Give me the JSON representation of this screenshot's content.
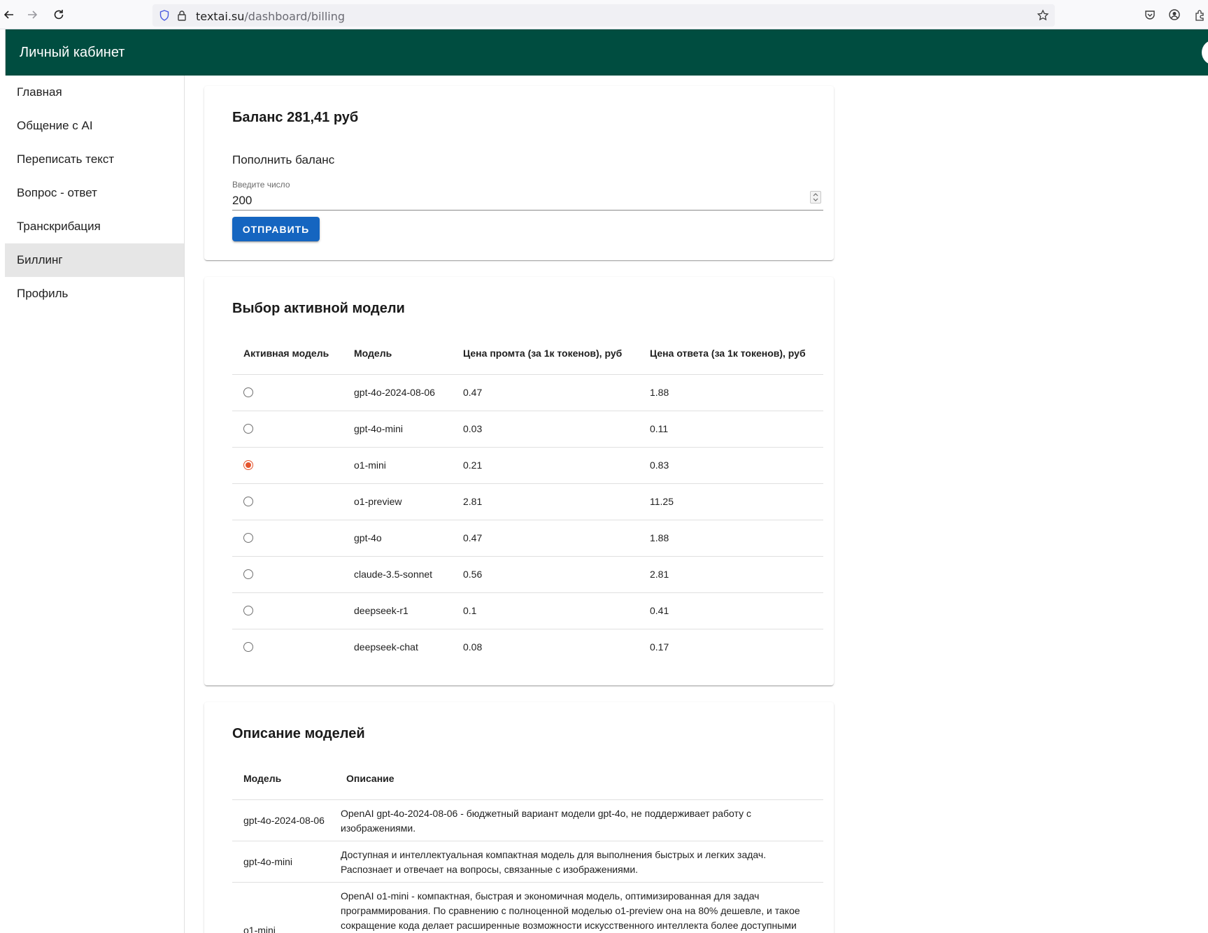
{
  "browser": {
    "url_host": "textai.su",
    "url_path": "/dashboard/billing"
  },
  "header": {
    "title": "Личный кабинет"
  },
  "sidebar": {
    "items": [
      {
        "label": "Главная"
      },
      {
        "label": "Общение с AI"
      },
      {
        "label": "Переписать текст"
      },
      {
        "label": "Вопрос - ответ"
      },
      {
        "label": "Транскрибация"
      },
      {
        "label": "Биллинг",
        "active": true
      },
      {
        "label": "Профиль"
      }
    ]
  },
  "balance": {
    "title": "Баланс 281,41 руб",
    "topup_label": "Пополнить баланс",
    "input_label": "Введите число",
    "input_value": "200",
    "submit_label": "ОТПРАВИТЬ"
  },
  "models": {
    "title": "Выбор активной модели",
    "headers": [
      "Активная модель",
      "Модель",
      "Цена промта (за 1к токенов), руб",
      "Цена ответа (за 1к токенов), руб"
    ],
    "rows": [
      {
        "model": "gpt-4o-2024-08-06",
        "prompt_price": "0.47",
        "answer_price": "1.88",
        "active": false
      },
      {
        "model": "gpt-4o-mini",
        "prompt_price": "0.03",
        "answer_price": "0.11",
        "active": false
      },
      {
        "model": "o1-mini",
        "prompt_price": "0.21",
        "answer_price": "0.83",
        "active": true
      },
      {
        "model": "o1-preview",
        "prompt_price": "2.81",
        "answer_price": "11.25",
        "active": false
      },
      {
        "model": "gpt-4o",
        "prompt_price": "0.47",
        "answer_price": "1.88",
        "active": false
      },
      {
        "model": "claude-3.5-sonnet",
        "prompt_price": "0.56",
        "answer_price": "2.81",
        "active": false
      },
      {
        "model": "deepseek-r1",
        "prompt_price": "0.1",
        "answer_price": "0.41",
        "active": false
      },
      {
        "model": "deepseek-chat",
        "prompt_price": "0.08",
        "answer_price": "0.17",
        "active": false
      }
    ]
  },
  "descriptions": {
    "title": "Описание моделей",
    "headers": [
      "Модель",
      "Описание"
    ],
    "rows": [
      {
        "model": "gpt-4o-2024-08-06",
        "text": "OpenAI gpt-4o-2024-08-06 - бюджетный вариант модели gpt-4o, не поддерживает работу с изображениями."
      },
      {
        "model": "gpt-4o-mini",
        "text": "Доступная и интеллектуальная компактная модель для выполнения быстрых и легких задач. Распознает и отвечает на вопросы, связанные с изображениями."
      },
      {
        "model": "o1-mini",
        "text": "OpenAI o1-mini - компактная, быстрая и экономичная модель, оптимизированная для задач программирования. По сравнению с полноценной моделью o1-preview она на 80% дешевле, и такое сокращение кода делает расширенные возможности искусственного интеллекта более доступными"
      }
    ]
  }
}
